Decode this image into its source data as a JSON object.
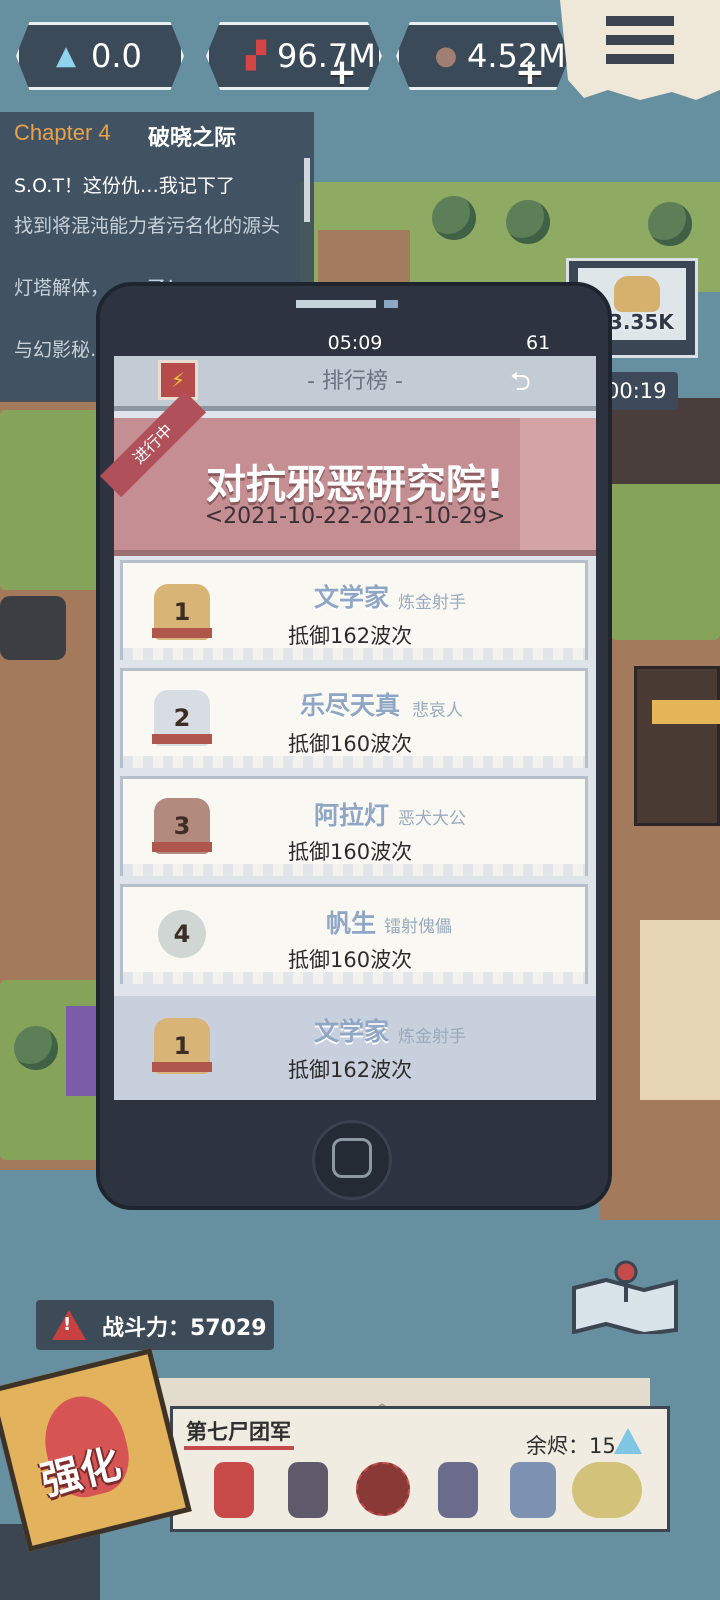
{
  "resources": [
    {
      "icon": "diamond-icon",
      "value": "0.0",
      "plus": false
    },
    {
      "icon": "gem-cluster-icon",
      "value": "96.7M",
      "plus": true
    },
    {
      "icon": "ore-icon",
      "value": "4.52M",
      "plus": true
    }
  ],
  "quest": {
    "chapter": "Chapter 4",
    "title": "破晓之际",
    "lines": [
      "S.O.T！这份仇…我记下了",
      "找到将混沌能力者污名化的源头",
      "灯塔解体，……了！",
      "与幻影秘……"
    ]
  },
  "phone": {
    "time": "05:09",
    "battery": "61",
    "header_title": "- 排行榜 -",
    "event": {
      "badge": "进行中",
      "title": "对抗邪恶研究院!",
      "date": "<2021-10-22-2021-10-29>"
    },
    "rows": [
      {
        "rank": "1",
        "name": "文学家",
        "title": "炼金射手",
        "score": "抵御162波次"
      },
      {
        "rank": "2",
        "name": "乐尽天真",
        "title": "悲哀人",
        "score": "抵御160波次"
      },
      {
        "rank": "3",
        "name": "阿拉灯",
        "title": "恶犬大公",
        "score": "抵御160波次"
      },
      {
        "rank": "4",
        "name": "帆生",
        "title": "镭射傀儡",
        "score": "抵御160波次"
      }
    ],
    "self_row": {
      "rank": "1",
      "name": "文学家",
      "title": "炼金射手",
      "score": "抵御162波次"
    }
  },
  "chest": {
    "multiplier": "x3.35K",
    "timer": "00:19"
  },
  "power": {
    "label": "战斗力：57029"
  },
  "team": {
    "name": "第七尸团军",
    "ember_label": "余烬：15"
  },
  "boost_label": "强化",
  "colors": {
    "medal_gold": "#d8b577",
    "medal_silver": "#d7dde2",
    "medal_bronze": "#b28a7e",
    "medal_plain": "#cfd6d3",
    "accent_red": "#c44b4b"
  }
}
